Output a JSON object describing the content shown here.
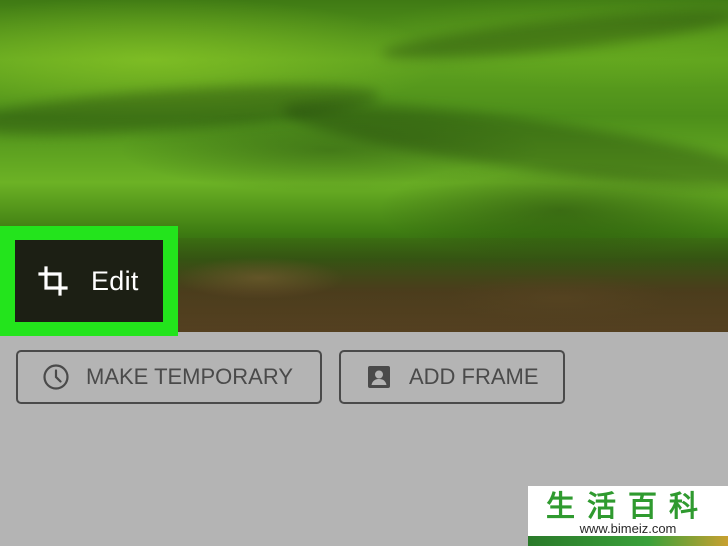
{
  "photo": {
    "edit_label": "Edit"
  },
  "actions": {
    "make_temporary_label": "MAKE TEMPORARY",
    "add_frame_label": "ADD FRAME"
  },
  "icons": {
    "edit": "crop-icon",
    "make_temporary": "clock-icon",
    "add_frame": "portrait-frame-icon"
  },
  "watermark": {
    "brand": "生活百科",
    "url": "www.bimeiz.com"
  },
  "colors": {
    "highlight": "#23e41c",
    "button_border": "#4a4a4a",
    "background": "#b4b4b4",
    "watermark_green": "#2f9a2f"
  }
}
